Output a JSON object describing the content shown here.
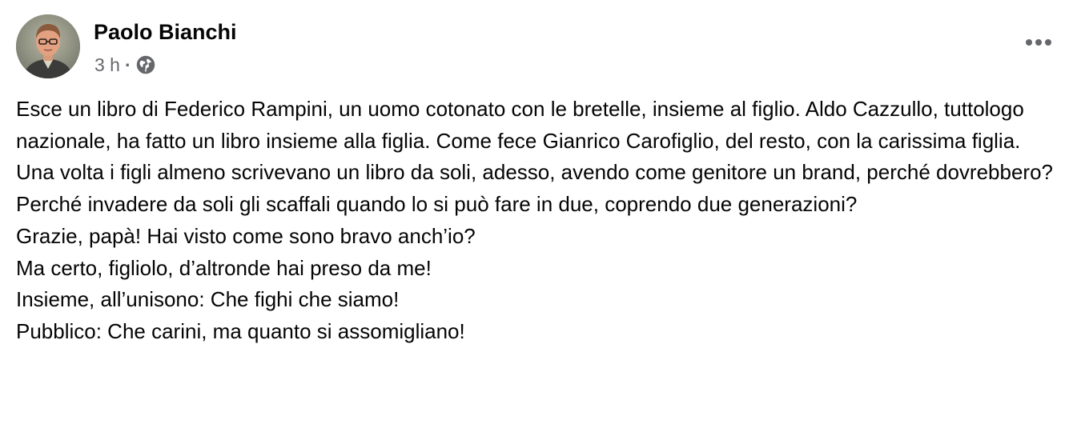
{
  "post": {
    "author": "Paolo Bianchi",
    "time": "3 h",
    "separator": "·",
    "audience_icon": "globe-icon",
    "more_icon": "more-options-icon",
    "paragraphs": [
      "Esce un libro di Federico Rampini, un uomo cotonato con le bretelle, insieme al figlio. Aldo Cazzullo, tuttologo nazionale, ha fatto un libro insieme alla figlia. Come fece Gianrico Carofiglio, del resto, con la carissima figlia.",
      "Una volta i figli almeno scrivevano un libro da soli, adesso, avendo come genitore un brand, perché dovrebbero? Perché invadere da soli gli scaffali quando lo si può fare in due, coprendo due generazioni?",
      "Grazie, papà! Hai visto come sono bravo anch’io?",
      "Ma certo, figliolo, d’altronde hai preso da me!",
      "Insieme, all’unisono: Che fighi che siamo!",
      "Pubblico: Che carini, ma quanto si assomigliano!"
    ]
  },
  "colors": {
    "text": "#050505",
    "secondary_text": "#65676b",
    "background": "#ffffff"
  }
}
